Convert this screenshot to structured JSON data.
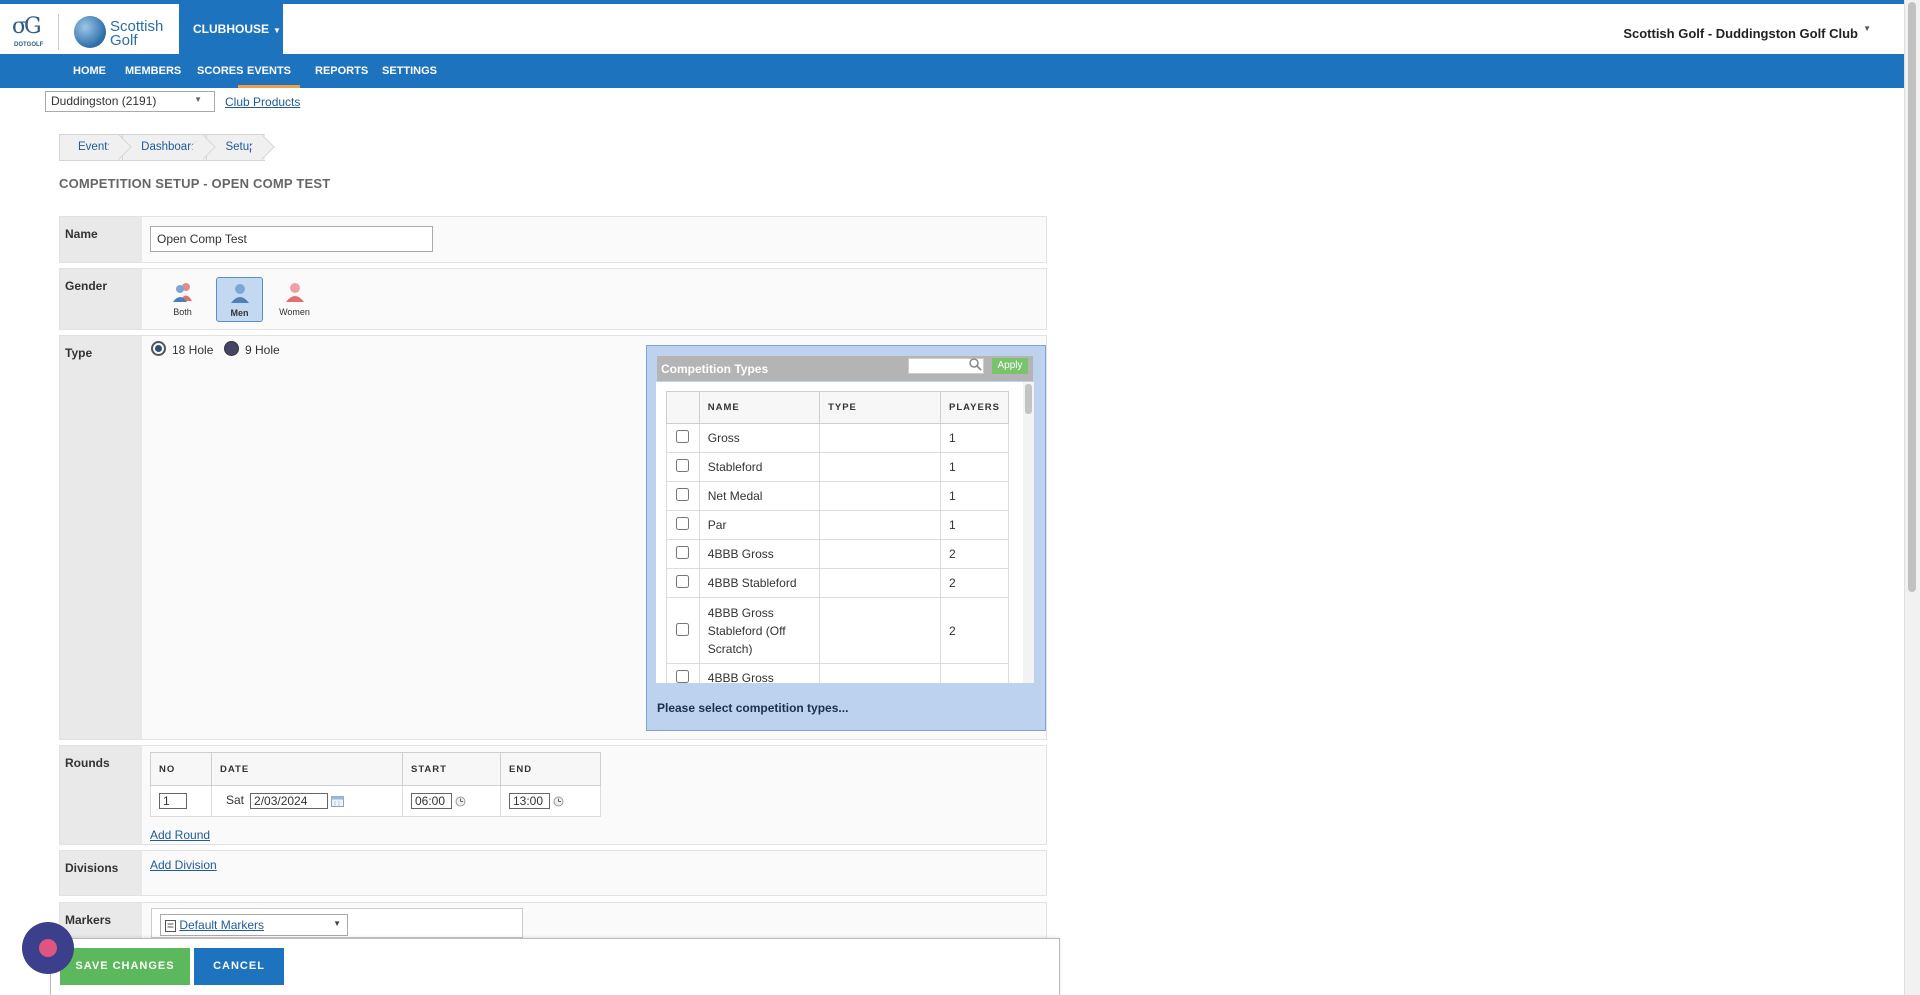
{
  "header": {
    "dotgolf_logo_text": "DOTGOLF",
    "sg_logo_line1": "Scottish",
    "sg_logo_line2": "Golf",
    "clubhouse_label": "CLUBHOUSE",
    "club_name": "Scottish Golf - Duddingston Golf Club"
  },
  "nav": {
    "items": [
      "HOME",
      "MEMBERS",
      "SCORES",
      "EVENTS",
      "REPORTS",
      "SETTINGS"
    ],
    "active": "EVENTS"
  },
  "club_selector": {
    "value": "Duddingston (2191)",
    "products_link": "Club Products"
  },
  "breadcrumb": [
    "Events",
    "Dashboard",
    "Setup"
  ],
  "page_title": "COMPETITION SETUP - OPEN COMP TEST",
  "form": {
    "name_label": "Name",
    "name_value": "Open Comp Test",
    "gender_label": "Gender",
    "gender_options": [
      "Both",
      "Men",
      "Women"
    ],
    "gender_selected": "Men",
    "type_label": "Type",
    "type_options": [
      "18 Hole",
      "9 Hole"
    ],
    "rounds_label": "Rounds",
    "divisions_label": "Divisions",
    "markers_label": "Markers"
  },
  "competition_types": {
    "title": "Competition Types",
    "search_placeholder": "",
    "apply_label": "Apply",
    "columns": [
      "NAME",
      "TYPE",
      "PLAYERS"
    ],
    "rows": [
      {
        "name": "Gross",
        "type": "",
        "players": "1"
      },
      {
        "name": "Stableford",
        "type": "",
        "players": "1"
      },
      {
        "name": "Net Medal",
        "type": "",
        "players": "1"
      },
      {
        "name": "Par",
        "type": "",
        "players": "1"
      },
      {
        "name": "4BBB Gross",
        "type": "",
        "players": "2"
      },
      {
        "name": "4BBB Stableford",
        "type": "",
        "players": "2"
      },
      {
        "name": "4BBB Gross Stableford (Off Scratch)",
        "type": "",
        "players": "2"
      },
      {
        "name": "4BBB Gross",
        "type": "",
        "players": ""
      }
    ],
    "message": "Please select competition types..."
  },
  "rounds": {
    "columns": [
      "NO",
      "DATE",
      "START",
      "END"
    ],
    "rows": [
      {
        "no": "1",
        "day": "Sat",
        "date": "2/03/2024",
        "start": "06:00",
        "end": "13:00"
      }
    ],
    "add_round": "Add Round"
  },
  "divisions": {
    "add_division": "Add Division"
  },
  "markers": {
    "selected": "Default Markers"
  },
  "actions": {
    "save": "SAVE CHANGES",
    "cancel": "CANCEL"
  },
  "colors": {
    "brand_blue": "#1e73be",
    "save_green": "#5cb85c",
    "nav_active_underline": "#f0a04b",
    "panel_blue": "#bcd2ee"
  }
}
